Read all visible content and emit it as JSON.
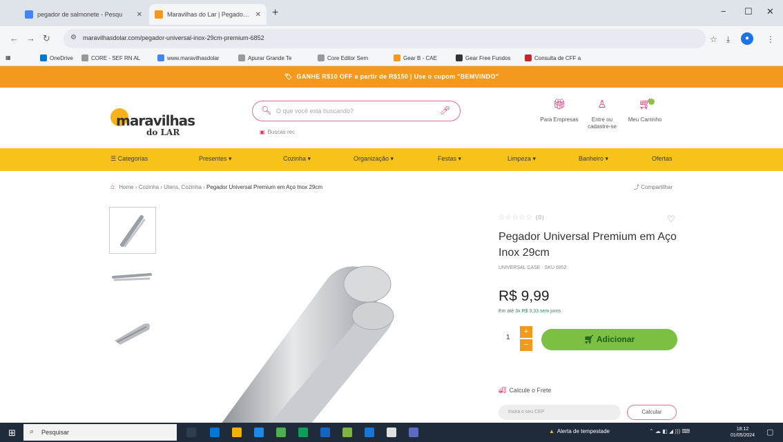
{
  "browser": {
    "tabs": [
      {
        "title": "pegador de salmonete - Pesqu",
        "active": false
      },
      {
        "title": "Maravilhas do Lar | Pegador Un",
        "active": true
      }
    ],
    "new_tab": "+",
    "window_controls": {
      "minimize": "−",
      "maximize": "☐",
      "close": "✕"
    },
    "url": "maravilhasdolar.com/pegador-universal-inox-29cm-premium-6852",
    "bookmarks": [
      "OneDrive",
      "CORE - SEF RN AL",
      "www.maravilhasdolar",
      "Apurar Grande Te",
      "Core Editor Sem",
      "Gear B - CAE",
      "Gear Free Fundos",
      "Consulta de CFF a"
    ]
  },
  "site": {
    "promo_text": "GANHE R$10 OFF a partir de R$150 | Use o cupom \"BEMVINDO\"",
    "logo": {
      "word1": "maravilhas",
      "word2": "do LAR"
    },
    "search": {
      "placeholder": "O que você está buscando?",
      "recent": "Buscas rec"
    },
    "header_actions": [
      {
        "icon": "gift-icon",
        "label": "Para Empresas"
      },
      {
        "icon": "user-icon",
        "label": "Entre ou cadastre-se"
      },
      {
        "icon": "cart-icon",
        "label": "Meu Carrinho"
      }
    ],
    "categories": [
      "☰ Categorias",
      "Presentes ▾",
      "Cozinha ▾",
      "Organização ▾",
      "Festas ▾",
      "Limpeza ▾",
      "Banheiro ▾",
      "Ofertas"
    ],
    "breadcrumb": {
      "items": [
        "Home",
        "Cozinha",
        "Utens. Cozinha"
      ],
      "current": "Pegador Universal Premium em Aço Inox 29cm"
    },
    "share_label": "Compartilhar"
  },
  "product": {
    "rating_stars": "☆☆☆☆☆",
    "rating_count": "(0)",
    "title": "Pegador Universal Premium em Aço Inox 29cm",
    "sku": "UNIVERSAL CASE · SKU 6852",
    "price": "R$ 9,99",
    "installments": "Em até 3x R$ 3,33 sem juros",
    "quantity": "1",
    "qty_plus": "+",
    "qty_minus": "−",
    "add_button": "Adicionar",
    "shipping_label": "Calcule o Frete",
    "cep_placeholder": "Insira o seu CEP",
    "calc_button": "Calcular"
  },
  "taskbar": {
    "search_placeholder": "Pesquisar",
    "weather": "Alerta de tempestade",
    "time": "18:12",
    "date": "01/05/2024"
  },
  "colors": {
    "brand_pink": "#d6336c",
    "promo_orange": "#f39a1e",
    "nav_yellow": "#f7c31a",
    "add_green": "#7bc043"
  }
}
